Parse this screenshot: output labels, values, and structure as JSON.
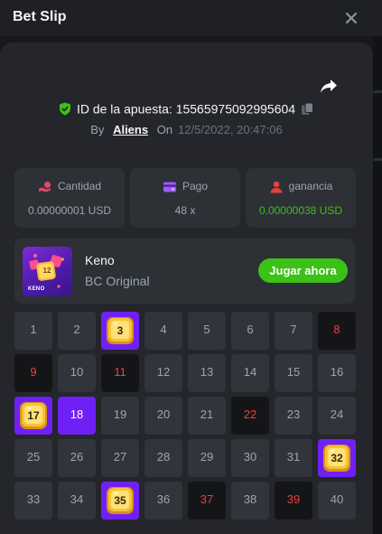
{
  "header": {
    "title": "Bet Slip"
  },
  "bet": {
    "id_label": "ID de la apuesta:",
    "id_value": "15565975092995604",
    "by_label": "By",
    "user": "Aliens",
    "on_label": "On",
    "date": "12/5/2022, 20:47:06"
  },
  "stats": {
    "amount": {
      "label": "Cantidad",
      "value": "0.00000001 USD"
    },
    "payout": {
      "label": "Pago",
      "value": "48 x"
    },
    "profit": {
      "label": "ganancia",
      "value": "0.00000038 USD"
    }
  },
  "game": {
    "name": "Keno",
    "provider": "BC Original",
    "play_label": "Jugar ahora",
    "thumb_text": "KENO",
    "thumb_number": "12"
  },
  "colors": {
    "accent_purple": "#7020f5",
    "win_green": "#3bc117",
    "hit_red": "#ed3f46",
    "gem_gold": "#f7c331",
    "verified_green": "#3bc117",
    "profit_icon_red": "#e74040"
  },
  "icons": {
    "close": "close-icon",
    "share": "share-icon",
    "verified": "shield-check-icon",
    "copy": "copy-icon",
    "amount": "coin-hand-icon",
    "payout": "wallet-icon",
    "profit": "user-icon"
  },
  "board": {
    "rows": 5,
    "cols": 8,
    "selected_hits": [
      3,
      17,
      32,
      35
    ],
    "selected": [
      18
    ],
    "drawn_misses": [
      8,
      9,
      11,
      22,
      37,
      39
    ],
    "cells": [
      "1",
      "2",
      "3",
      "4",
      "5",
      "6",
      "7",
      "8",
      "9",
      "10",
      "11",
      "12",
      "13",
      "14",
      "15",
      "16",
      "17",
      "18",
      "19",
      "20",
      "21",
      "22",
      "23",
      "24",
      "25",
      "26",
      "27",
      "28",
      "29",
      "30",
      "31",
      "32",
      "33",
      "34",
      "35",
      "36",
      "37",
      "38",
      "39",
      "40"
    ]
  }
}
